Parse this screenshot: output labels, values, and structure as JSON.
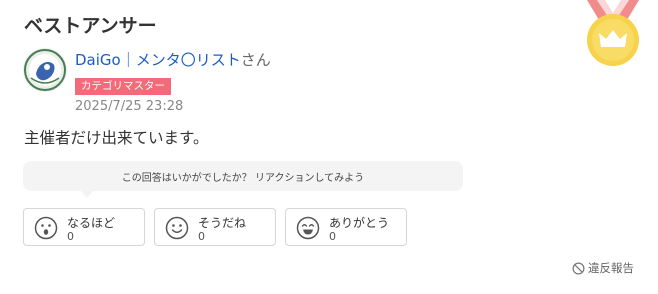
{
  "header": {
    "title": "ベストアンサー"
  },
  "answer_user": {
    "name": "DaiGo｜メンタ〇リスト",
    "suffix": "さん",
    "badge": "カテゴリマスター",
    "timestamp": "2025/7/25 23:28"
  },
  "answer": {
    "body": "主催者だけ出来ています。"
  },
  "reactions": {
    "prompt": "この回答はいかがでしたか？ リアクションしてみよう",
    "items": [
      {
        "label": "なるほど",
        "count": "0",
        "icon": "surprised-face-icon"
      },
      {
        "label": "そうだね",
        "count": "0",
        "icon": "smile-face-icon"
      },
      {
        "label": "ありがとう",
        "count": "0",
        "icon": "grin-face-icon"
      }
    ]
  },
  "report": {
    "label": "違反報告",
    "icon": "prohibit-icon"
  },
  "colors": {
    "link": "#1a5cc7",
    "badge": "#f56a7b",
    "medal": "#f7d24b",
    "ribbon": "#f28b8b"
  }
}
